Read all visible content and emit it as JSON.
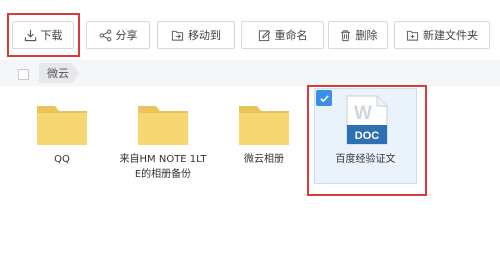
{
  "toolbar": {
    "download_label": "下载",
    "share_label": "分享",
    "move_label": "移动到",
    "rename_label": "重命名",
    "delete_label": "删除",
    "new_folder_label": "新建文件夹"
  },
  "breadcrumb": {
    "root": "微云"
  },
  "files": [
    {
      "name_line1": "QQ",
      "name_line2": "",
      "type": "folder"
    },
    {
      "name_line1": "来自HM NOTE 1LT",
      "name_line2": "E的相册备份",
      "type": "folder"
    },
    {
      "name_line1": "微云相册",
      "name_line2": "",
      "type": "folder"
    },
    {
      "name_line1": "百度经验证文",
      "name_line2": "",
      "type": "doc",
      "badge": "DOC",
      "letter": "W",
      "selected": true
    }
  ],
  "colors": {
    "highlight": "#d93a3a",
    "folder": "#f7d774",
    "folder_dark": "#e9c45a",
    "doc_blue": "#2f6fb3",
    "check_blue": "#3b8fe6"
  }
}
